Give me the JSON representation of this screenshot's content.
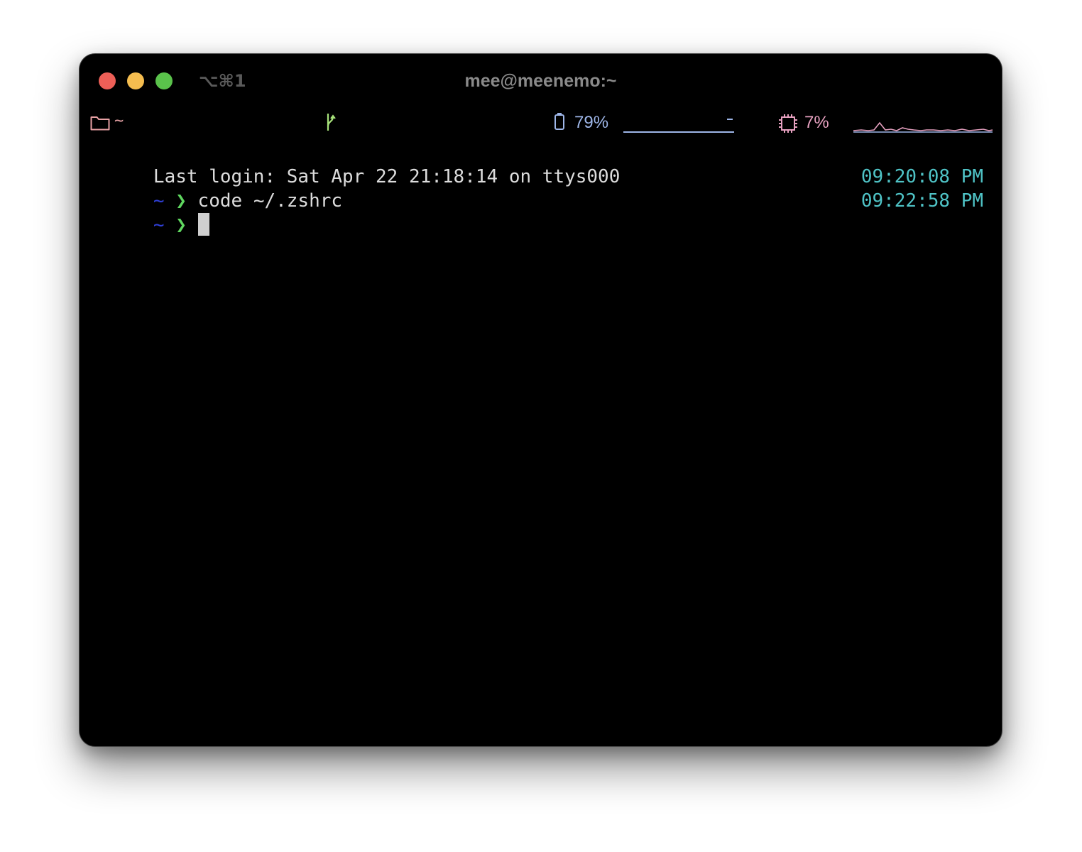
{
  "window": {
    "title": "mee@meenemo:~",
    "shortcut": "⌥⌘1",
    "traffic_lights": {
      "close": "#ed5f57",
      "minimize": "#f5bd4f",
      "maximize": "#5ac24b"
    }
  },
  "statusbar": {
    "folder_icon": "folder-icon",
    "path": "~",
    "branch_icon": "git-branch-icon",
    "battery_icon": "battery-icon",
    "battery_percent": "79%",
    "cpu_icon": "cpu-chip-icon",
    "cpu_percent": "7%",
    "colors": {
      "path": "#e7a1a4",
      "branch": "#a7e27a",
      "battery": "#9eb6e8",
      "cpu": "#e7a1c0"
    }
  },
  "terminal": {
    "last_login": "Last login: Sat Apr 22 21:18:14 on ttys000",
    "prompt_dir": "~",
    "prompt_symbol": "❯",
    "lines": [
      {
        "command": "code ~/.zshrc",
        "time": "09:20:08 PM"
      },
      {
        "command": "",
        "time": "09:22:58 PM"
      }
    ],
    "colors": {
      "text": "#dcdcdc",
      "prompt_dir": "#2f3fd6",
      "prompt_symbol": "#5fd75f",
      "time": "#4fc3c6"
    }
  }
}
